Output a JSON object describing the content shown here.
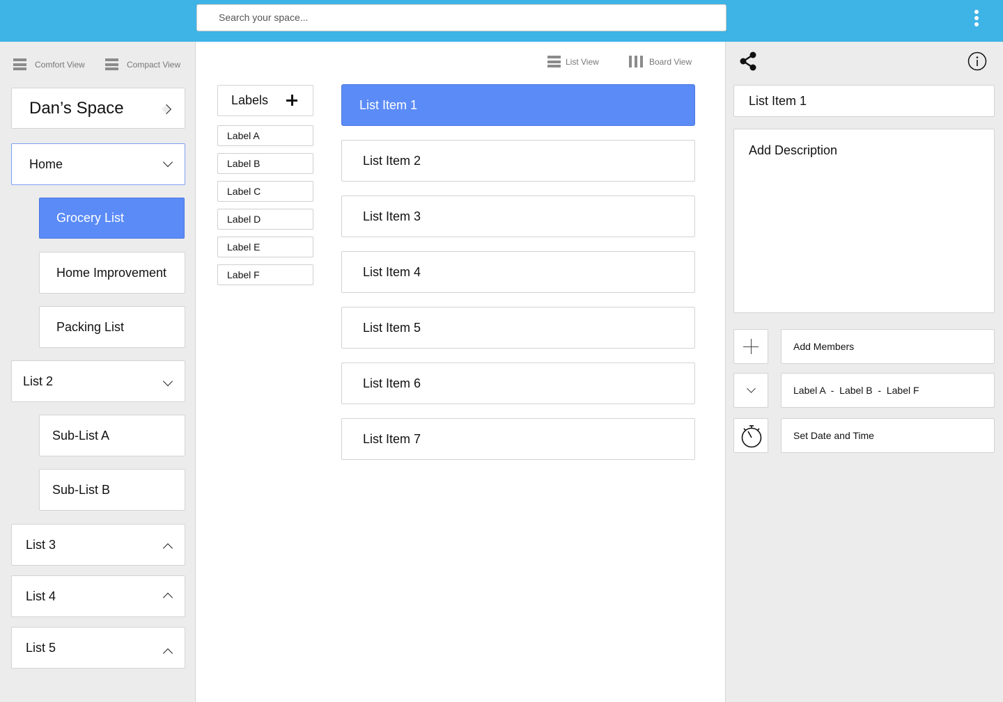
{
  "search": {
    "placeholder": "Search your space..."
  },
  "sidebar": {
    "comfort_view": "Comfort View",
    "compact_view": "Compact View",
    "space_title": "Dan’s Space",
    "nav": [
      {
        "label": "Home"
      },
      {
        "label": "Grocery List"
      },
      {
        "label": "Home Improvement"
      },
      {
        "label": "Packing List"
      },
      {
        "label": "List 2"
      },
      {
        "label": "Sub-List A"
      },
      {
        "label": "Sub-List B"
      },
      {
        "label": "List 3"
      },
      {
        "label": "List 4"
      },
      {
        "label": "List 5"
      }
    ]
  },
  "main": {
    "list_view": "List View",
    "board_view": "Board View",
    "labels_header": "Labels",
    "labels": [
      "Label A",
      "Label B",
      "Label C",
      "Label D",
      "Label E",
      "Label F"
    ],
    "items": [
      "List Item 1",
      "List Item 2",
      "List Item 3",
      "List Item 4",
      "List Item 5",
      "List Item 6",
      "List Item 7"
    ],
    "selected_item": "List Item 1"
  },
  "detail": {
    "title": "List Item 1",
    "description_placeholder": "Add Description",
    "add_members": "Add Members",
    "labels_summary": "Label A  -  Label B  -  Label F",
    "set_date": "Set Date and Time"
  },
  "colors": {
    "topbar": "#3db3e6",
    "selected": "#5b8bf7",
    "panel_bg": "#ececec"
  },
  "icons": {
    "menu": "kebab-icon",
    "comfort": "list-lines-icon",
    "compact": "list-lines-icon",
    "list_view": "list-lines-icon",
    "board_view": "columns-icon",
    "share": "share-icon",
    "info": "info-icon",
    "add": "plus-icon",
    "expand": "chevron-down-icon",
    "timer": "stopwatch-icon"
  }
}
